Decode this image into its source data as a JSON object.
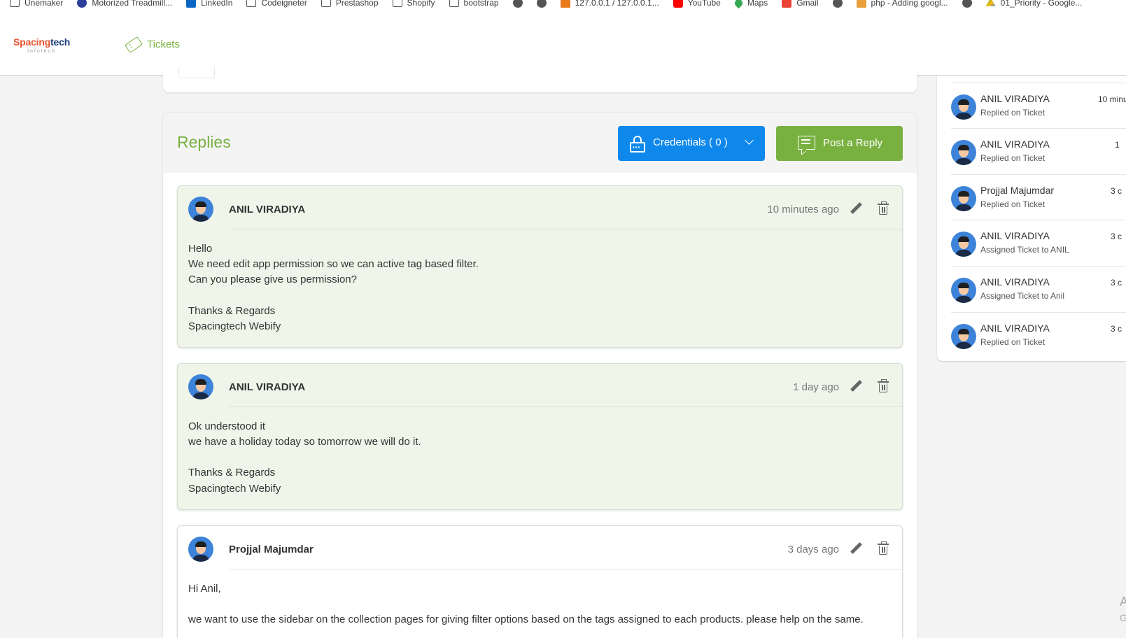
{
  "bookmarks": [
    {
      "label": "Unemaker",
      "icon": "folder-icon"
    },
    {
      "label": "Motorized Treadmill...",
      "icon": "brand-icon"
    },
    {
      "label": "LinkedIn",
      "icon": "linkedin-icon"
    },
    {
      "label": "Codeigneter",
      "icon": "folder-icon"
    },
    {
      "label": "Prestashop",
      "icon": "folder-icon"
    },
    {
      "label": "Shopify",
      "icon": "folder-icon"
    },
    {
      "label": "bootstrap",
      "icon": "folder-icon"
    },
    {
      "label": "",
      "icon": "globe-icon"
    },
    {
      "label": "",
      "icon": "globe-icon"
    },
    {
      "label": "127.0.0.1 / 127.0.0.1...",
      "icon": "phpmyadmin-icon"
    },
    {
      "label": "YouTube",
      "icon": "youtube-icon"
    },
    {
      "label": "Maps",
      "icon": "maps-icon"
    },
    {
      "label": "Gmail",
      "icon": "gmail-icon"
    },
    {
      "label": "",
      "icon": "globe-icon"
    },
    {
      "label": "php - Adding googl...",
      "icon": "stackoverflow-icon"
    },
    {
      "label": "",
      "icon": "globe-icon"
    },
    {
      "label": "01_Priority - Google...",
      "icon": "google-drive-icon"
    }
  ],
  "header": {
    "logo_main_a": "Spacing",
    "logo_main_b": "tech",
    "logo_sub": "Infotech",
    "nav_tickets": "Tickets"
  },
  "replies": {
    "title": "Replies",
    "credentials_label": "Credentials ( 0 )",
    "post_reply_label": "Post a Reply",
    "items": [
      {
        "author": "ANIL VIRADIYA",
        "time": "10 minutes ago",
        "lines": [
          "Hello",
          "We need edit app permission so we can active tag based filter.",
          "Can you please give us permission?",
          "",
          "Thanks & Regards",
          "Spacingtech Webify"
        ]
      },
      {
        "author": "ANIL VIRADIYA",
        "time": "1 day ago",
        "lines": [
          "Ok understood it",
          "we have a holiday today so tomorrow we will do it.",
          "",
          "Thanks & Regards",
          "Spacingtech Webify"
        ]
      },
      {
        "author": "Projjal Majumdar",
        "time": "3 days ago",
        "lines": [
          "Hi Anil,",
          "",
          "we want to use the sidebar on the collection pages for giving filter options based on the tags assigned to each products. please help on the same."
        ]
      }
    ]
  },
  "activity": [
    {
      "name": "ANIL VIRADIYA",
      "action": "Replied on Ticket",
      "time": "10 minu"
    },
    {
      "name": "ANIL VIRADIYA",
      "action": "Replied on Ticket",
      "time": "1"
    },
    {
      "name": "Projjal Majumdar",
      "action": "Replied on Ticket",
      "time": "3 c"
    },
    {
      "name": "ANIL VIRADIYA",
      "action": "Assigned Ticket to ANIL",
      "time": "3 c"
    },
    {
      "name": "ANIL VIRADIYA",
      "action": "Assigned Ticket to Anil",
      "time": "3 c"
    },
    {
      "name": "ANIL VIRADIYA",
      "action": "Replied on Ticket",
      "time": "3 c"
    }
  ],
  "edge_text": [
    "A",
    "G"
  ]
}
